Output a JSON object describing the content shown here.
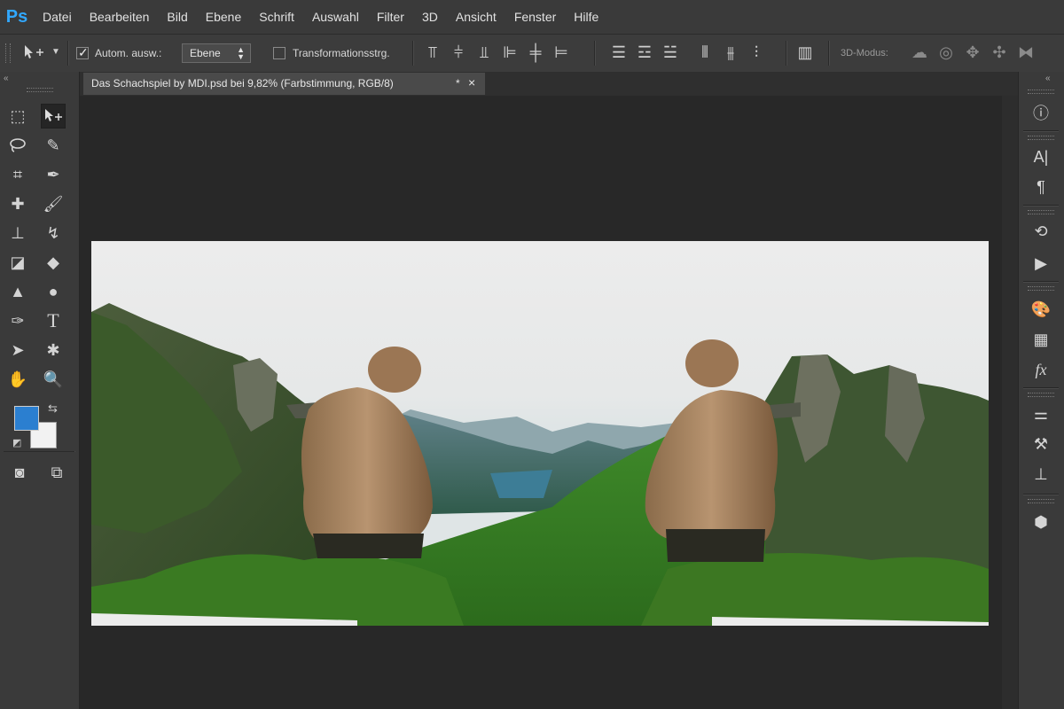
{
  "app": {
    "logo": "Ps"
  },
  "menu": [
    "Datei",
    "Bearbeiten",
    "Bild",
    "Ebene",
    "Schrift",
    "Auswahl",
    "Filter",
    "3D",
    "Ansicht",
    "Fenster",
    "Hilfe"
  ],
  "options": {
    "auto_select_label": "Autom. ausw.:",
    "auto_select_checked": true,
    "auto_select_value": "Ebene",
    "transform_label": "Transformationsstrg.",
    "transform_checked": false,
    "mode_3d_label": "3D-Modus:"
  },
  "document": {
    "tab_title": "Das Schachspiel by MDI.psd bei 9,82% (Farbstimmung, RGB/8)",
    "modified_marker": "*",
    "close_glyph": "×"
  },
  "colors": {
    "foreground": "#2b7fd0",
    "background": "#f2f2f2",
    "accent": "#31a8ff"
  },
  "icons": {
    "collapse_left": "«",
    "collapse_right": "«"
  }
}
